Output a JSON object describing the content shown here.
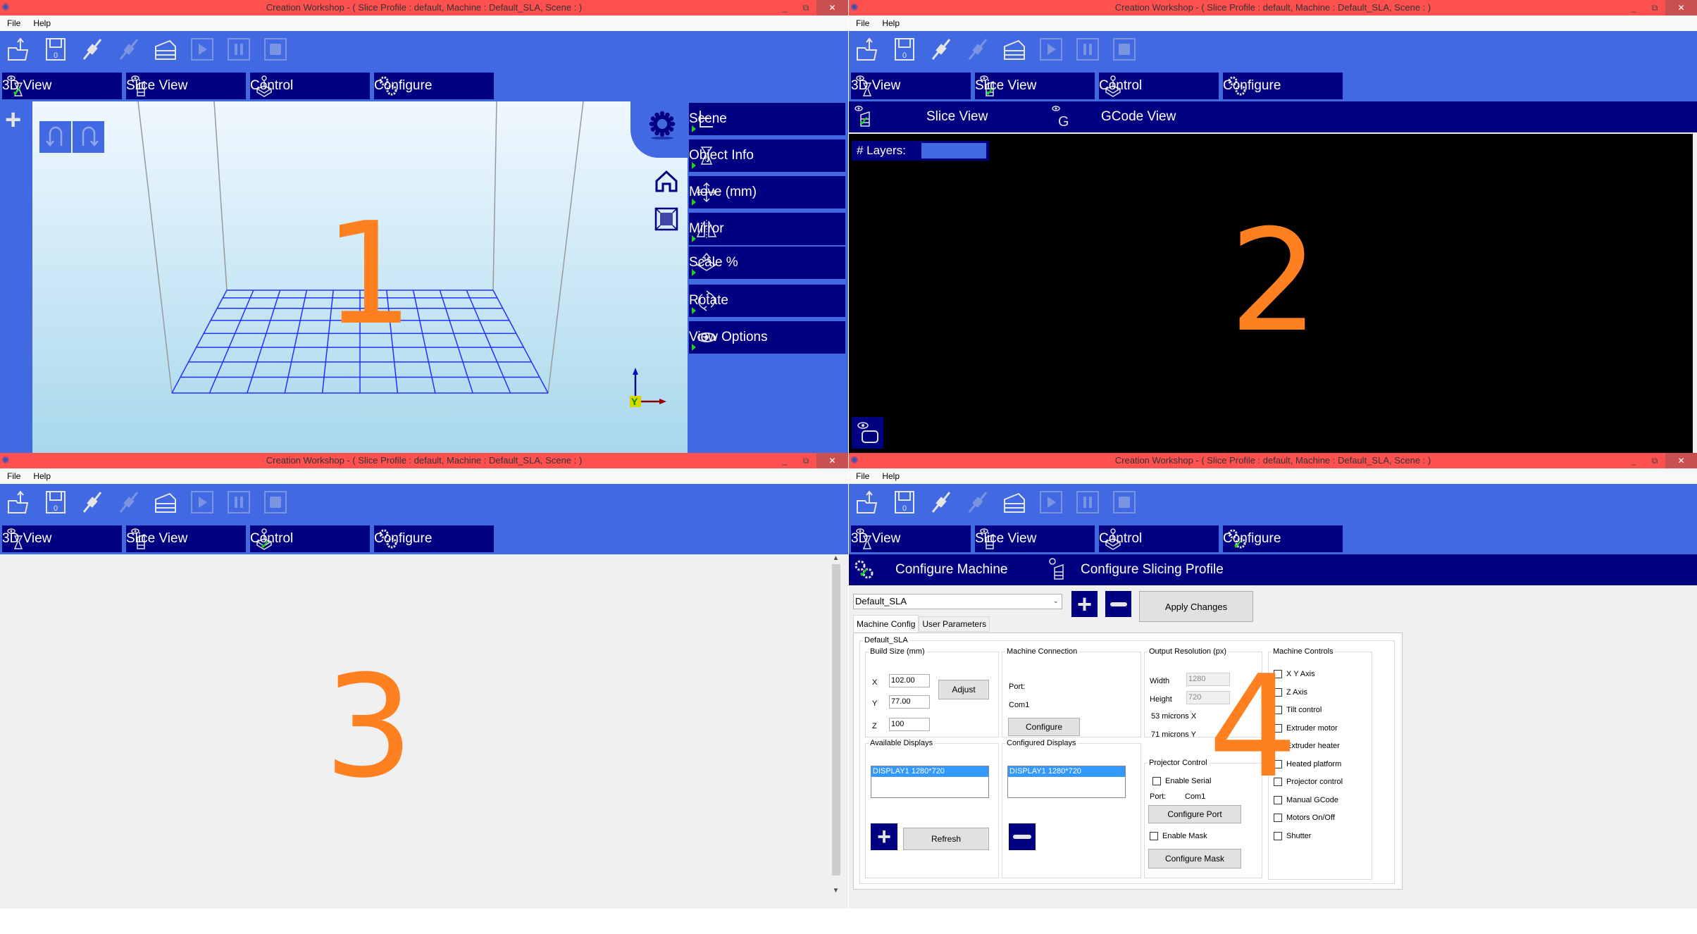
{
  "window": {
    "app_title": "Creation Workshop -    ( Slice Profile : default, Machine : Default_SLA, Scene : )",
    "menu": [
      "File",
      "Help"
    ],
    "controls": {
      "minimize": "_",
      "maximize": "⧉",
      "close": "✕"
    }
  },
  "toolbar": {
    "buttons": [
      {
        "name": "open-file",
        "enabled": true
      },
      {
        "name": "save",
        "enabled": true
      },
      {
        "name": "connect",
        "enabled": true
      },
      {
        "name": "disconnect",
        "enabled": false
      },
      {
        "name": "slice",
        "enabled": true
      },
      {
        "name": "play",
        "enabled": false
      },
      {
        "name": "pause",
        "enabled": false
      },
      {
        "name": "stop",
        "enabled": false
      }
    ]
  },
  "main_tabs": [
    {
      "label": "3D View",
      "icon": "eye-3d-icon"
    },
    {
      "label": "Slice View",
      "icon": "eye-slice-icon"
    },
    {
      "label": "Control",
      "icon": "joystick-icon"
    },
    {
      "label": "Configure",
      "icon": "gears-icon"
    }
  ],
  "panels": [
    {
      "number": "1",
      "active_tab": "3D View"
    },
    {
      "number": "2",
      "active_tab": "Slice View"
    },
    {
      "number": "3",
      "active_tab": "Control"
    },
    {
      "number": "4",
      "active_tab": "Configure"
    }
  ],
  "view3d": {
    "side_menu": [
      {
        "label": "Scene",
        "icon": "scene-tree-icon"
      },
      {
        "label": "Object Info",
        "icon": "object-info-icon"
      },
      {
        "label": "Move (mm)",
        "icon": "move-arrows-icon"
      },
      {
        "label": "Mirror",
        "icon": "mirror-icon"
      },
      {
        "label": "Scale %",
        "icon": "scale-icon"
      },
      {
        "label": "Rotate",
        "icon": "rotate-icon"
      },
      {
        "label": "View Options",
        "icon": "eye-icon"
      }
    ],
    "axis_label": "Y"
  },
  "slice_view": {
    "subtabs": [
      {
        "label": "Slice View",
        "icon": "slice-view-icon"
      },
      {
        "label": "GCode View",
        "icon": "gcode-view-icon"
      }
    ],
    "layers_label": "# Layers:",
    "layers_value": ""
  },
  "configure": {
    "subtabs": [
      {
        "label": "Configure Machine",
        "icon": "gears-icon"
      },
      {
        "label": "Configure Slicing Profile",
        "icon": "slice-profile-icon"
      }
    ],
    "machine_select": "Default_SLA",
    "apply_label": "Apply Changes",
    "tabs": [
      "Machine Config",
      "User Parameters"
    ],
    "group_title": "Default_SLA",
    "build_size": {
      "title": "Build Size (mm)",
      "x_label": "X",
      "x": "102.00",
      "y_label": "Y",
      "y": "77.00",
      "z_label": "Z",
      "z": "100",
      "adjust_label": "Adjust"
    },
    "machine_connection": {
      "title": "Machine Connection",
      "port_label": "Port:",
      "port": "Com1",
      "configure_label": "Configure"
    },
    "output_resolution": {
      "title": "Output Resolution (px)",
      "width_label": "Width",
      "width": "1280",
      "height_label": "Height",
      "height": "720",
      "microns_x": "53 microns X",
      "microns_y": "71 microns Y"
    },
    "machine_controls": {
      "title": "Machine Controls",
      "items": [
        {
          "label": "X Y Axis",
          "checked": false
        },
        {
          "label": "Z Axis",
          "checked": false
        },
        {
          "label": "Tilt control",
          "checked": false
        },
        {
          "label": "Extruder motor",
          "checked": false
        },
        {
          "label": "Extruder heater",
          "checked": false
        },
        {
          "label": "Heated platform",
          "checked": false
        },
        {
          "label": "Projector control",
          "checked": false
        },
        {
          "label": "Manual GCode",
          "checked": false
        },
        {
          "label": "Motors On/Off",
          "checked": false
        },
        {
          "label": "Shutter",
          "checked": false
        }
      ]
    },
    "available_displays": {
      "title": "Available Displays",
      "items": [
        "DISPLAY1 1280*720"
      ],
      "refresh_label": "Refresh"
    },
    "configured_displays": {
      "title": "Configured Displays",
      "items": [
        "DISPLAY1 1280*720"
      ]
    },
    "projector_control": {
      "title": "Projector Control",
      "enable_serial": "Enable Serial",
      "port_label": "Port:",
      "port": "Com1",
      "configure_port": "Configure Port",
      "enable_mask": "Enable Mask",
      "configure_mask": "Configure Mask"
    }
  },
  "colors": {
    "titlebar": "#ff5050",
    "toolbar": "#4169e1",
    "tab": "#000080",
    "check": "#22d022",
    "annotation": "#ff8020"
  }
}
